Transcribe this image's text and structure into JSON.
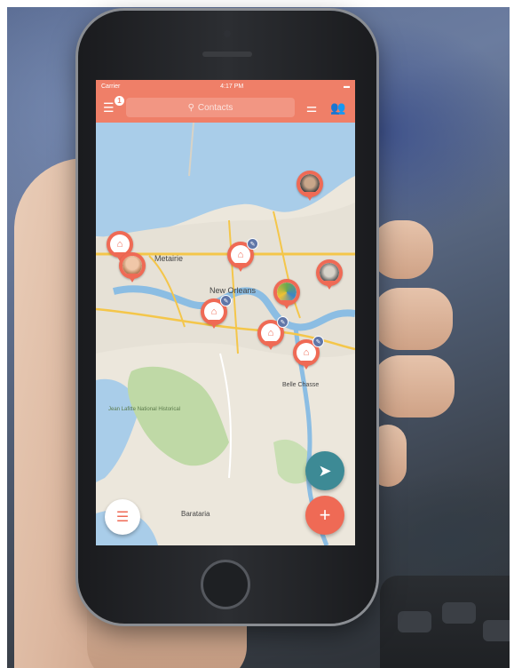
{
  "status_bar": {
    "carrier": "Carrier",
    "time": "4:17 PM"
  },
  "nav": {
    "notification_count": "1",
    "search_placeholder": "Contacts",
    "search_icon": "search-icon",
    "filter_icon": "sliders-icon",
    "group_icon": "people-icon",
    "menu_icon": "menu-icon"
  },
  "map": {
    "labels": {
      "metairie": "Metairie",
      "new_orleans": "New Orleans",
      "belle_chasse": "Belle Chasse",
      "barataria": "Barataria",
      "park": "Jean Lafitte National Historical"
    }
  },
  "pins": {
    "house_icon": "house-icon",
    "badge_icon": "pin-badge"
  },
  "actions": {
    "list_icon": "list-icon",
    "locate_icon": "navigation-arrow-icon",
    "add_icon": "plus-icon"
  },
  "colors": {
    "accent": "#ef7f68",
    "locate": "#3d8a95",
    "badge": "#5f76a8"
  }
}
